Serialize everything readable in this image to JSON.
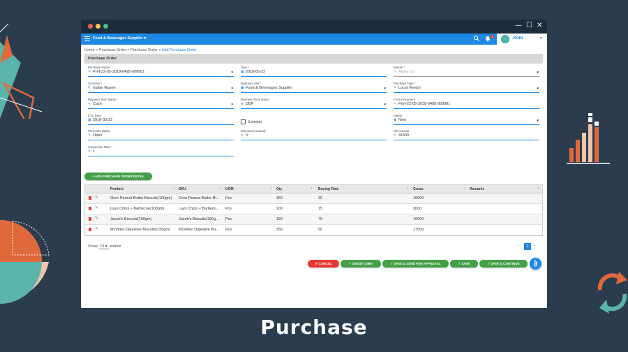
{
  "colors": {
    "background": "#2a3c4e",
    "appbar": "#1e88e5",
    "accent_green": "#43a047",
    "accent_red": "#e53935",
    "deco_orange": "#e0693b",
    "deco_teal": "#5ab4ac",
    "deco_peach": "#f0c4a8"
  },
  "window": {
    "close_glyph": "✕",
    "maximize_glyph": "☐",
    "minimize_glyph": "—"
  },
  "appbar": {
    "company": "Food & Beverages Supplier ▾",
    "search_icon": "search-icon",
    "bell_icon": "bell-icon",
    "notification_count": "1",
    "username": "JOHN",
    "user_caret": "▾"
  },
  "breadcrumb": {
    "items": "Home > Purchase Order > Purchase Order > ",
    "current": "Add Purchase Order"
  },
  "section_title": "Purchase Order",
  "form": {
    "purchase_indent": {
      "label": "Purchase Indent",
      "value": "Pref-22-05-2018-6495-000001"
    },
    "date": {
      "label": "Date",
      "value": "2018-05-22"
    },
    "vendor": {
      "label": "Vendor",
      "value": "Alpha Ltd"
    },
    "currency": {
      "label": "Currency",
      "value": "Indian Rupee"
    },
    "business_unit": {
      "label": "Business Unit",
      "value": "Food & Beverages Supplier"
    },
    "purchase_type": {
      "label": "Purchase Type",
      "value": "Local Vendor"
    },
    "payment_term": {
      "label": "Payment Term Name",
      "value": "Cash"
    },
    "business_term": {
      "label": "Business Term Name",
      "value": "DDP"
    },
    "from_document": {
      "label": "From Document",
      "value": "Pref-22-05-2018-6495-000001"
    },
    "eta_date": {
      "label": "ETD Date",
      "value": "2018-05-22"
    },
    "schedule": {
      "label": "Schedule"
    },
    "status": {
      "label": "Status",
      "value": "New"
    },
    "po_status": {
      "label": "PO to SO Status",
      "value": "Open"
    },
    "discount": {
      "label": "Discount (Amount)",
      "value": "0"
    },
    "net_amount": {
      "label": "Net Amount",
      "value": "41500"
    },
    "conversion_rate": {
      "label": "Conversion Rate",
      "value": "1"
    },
    "required_mark": "*"
  },
  "add_detail_button": "+ ADD PURCHASE ORDER DETAIL",
  "table": {
    "headers": [
      "Product",
      "SKU",
      "UOM",
      "Qty",
      "Buying Rate",
      "Gross",
      "Remarks"
    ],
    "sort_glyph": "↕",
    "rows": [
      [
        "Oreo Peanut Butter Biscuits(100gm)",
        "Oreo Peanut Butter Bi...",
        "Pcs",
        "350",
        "30",
        "10500",
        ""
      ],
      [
        "Lays Chips – Barbecue(100gm)",
        "Lays Chips – Barbecu...",
        "Pcs",
        "200",
        "15",
        "3000",
        ""
      ],
      [
        "Jacob's Biscuits(100gm)",
        "Jacob's Biscuits(100g...",
        "Pcs",
        "150",
        "70",
        "10500",
        ""
      ],
      [
        "McVities Digestive Biscuits(150gm)",
        "McVities Digestive Bis...",
        "Pcs",
        "350",
        "50",
        "17500",
        ""
      ]
    ]
  },
  "pagination": {
    "show": "Show",
    "entries_value": "10",
    "entries": "entries",
    "prev": "‹",
    "current": "1",
    "next": "›"
  },
  "actions": {
    "cancel": "✕ CANCEL",
    "credit_limit": "✓ CREDIT LIMIT",
    "save_send": "✓ SAVE & SEND FOR APPROVAL",
    "save": "✓ SAVE",
    "save_continue": "✓ SAVE & CONTINUE"
  },
  "attach_icon": "paperclip-icon",
  "caption": "Purchase"
}
